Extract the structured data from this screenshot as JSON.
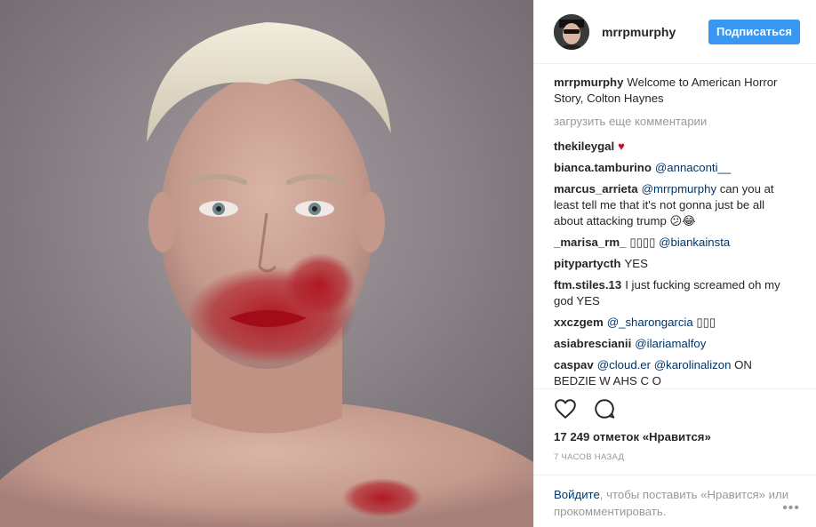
{
  "post": {
    "photo_alt": "Photo by mrrpmurphy"
  },
  "header": {
    "username": "mrrpmurphy",
    "follow_label": "Подписаться"
  },
  "caption": {
    "author": "mrrpmurphy",
    "text": "Welcome to American Horror Story, Colton Haynes"
  },
  "load_more_label": "загрузить еще комментарии",
  "comments": [
    {
      "author": "thekileygal",
      "parts": [
        {
          "t": "heart",
          "v": "♥"
        }
      ]
    },
    {
      "author": "bianca.tamburino",
      "parts": [
        {
          "t": "mention",
          "v": "@annaconti__"
        }
      ]
    },
    {
      "author": "marcus_arrieta",
      "parts": [
        {
          "t": "mention",
          "v": "@mrrpmurphy"
        },
        {
          "t": "text",
          "v": " can you at least tell me that it's not gonna just be all about attacking trump 😕😂"
        }
      ]
    },
    {
      "author": "_marisa_rm_",
      "parts": [
        {
          "t": "text",
          "v": "▯▯▯▯ "
        },
        {
          "t": "mention",
          "v": "@biankainsta"
        }
      ]
    },
    {
      "author": "pitypartycth",
      "parts": [
        {
          "t": "text",
          "v": "YES"
        }
      ]
    },
    {
      "author": "ftm.stiles.13",
      "parts": [
        {
          "t": "text",
          "v": "I just fucking screamed oh my god YES"
        }
      ]
    },
    {
      "author": "xxczgem",
      "parts": [
        {
          "t": "mention",
          "v": "@_sharongarcia"
        },
        {
          "t": "text",
          "v": " ▯▯▯"
        }
      ]
    },
    {
      "author": "asiabrescianii",
      "parts": [
        {
          "t": "mention",
          "v": "@ilariamalfoy"
        }
      ]
    },
    {
      "author": "caspav",
      "parts": [
        {
          "t": "mention",
          "v": "@cloud.er"
        },
        {
          "t": "text",
          "v": " "
        },
        {
          "t": "mention",
          "v": "@karolinalizon"
        },
        {
          "t": "text",
          "v": " ON BEDZIE W AHS C O"
        }
      ]
    }
  ],
  "actions": {
    "like_icon": "heart-outline-icon",
    "comment_icon": "speech-bubble-icon",
    "likes_text": "17 249 отметок «Нравится»",
    "time_text": "7 часов назад"
  },
  "login": {
    "link_text": "Войдите",
    "rest_text": ", чтобы поставить «Нравится» или прокомментировать.",
    "more_label": "•••"
  },
  "colors": {
    "follow_button": "#3897f0",
    "mention": "#003569",
    "muted": "#999999"
  }
}
